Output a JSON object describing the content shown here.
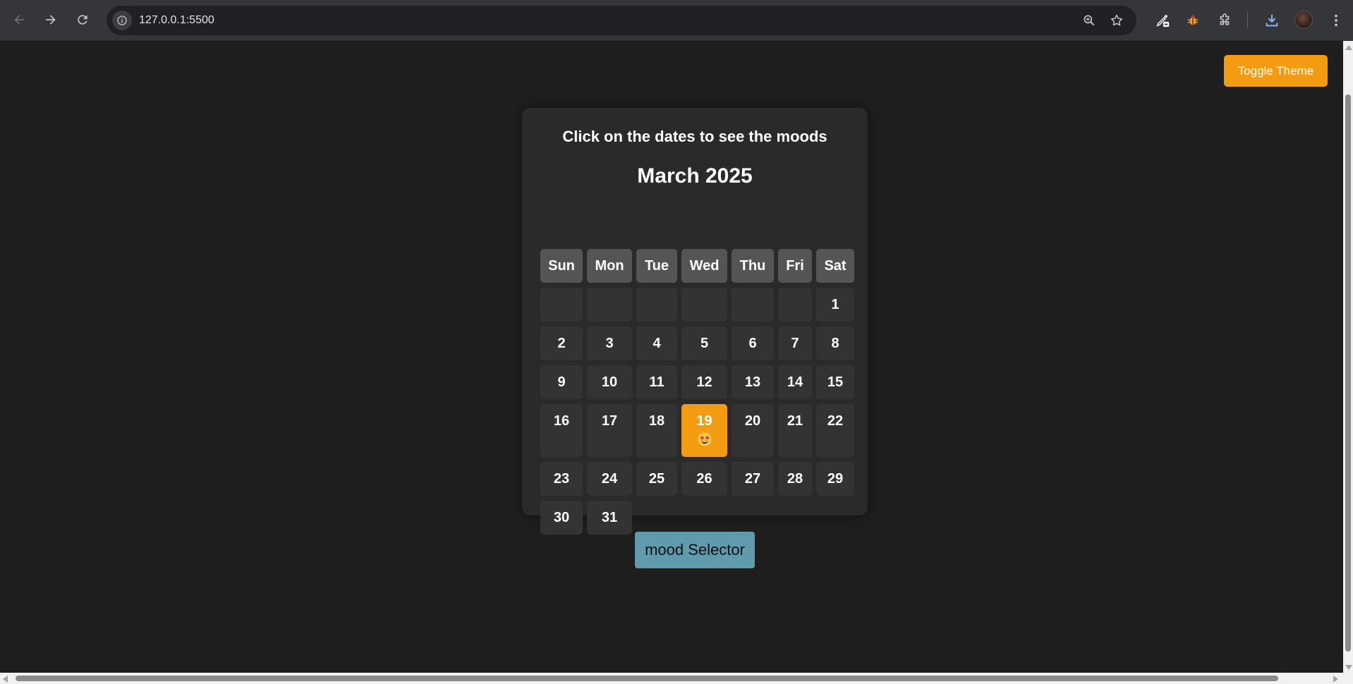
{
  "browser": {
    "url": "127.0.0.1:5500",
    "icons": [
      "back-arrow-icon",
      "forward-arrow-icon",
      "reload-icon",
      "site-info-icon",
      "zoom-icon",
      "bookmark-star-icon",
      "eyedropper-extension-icon",
      "bug-extension-icon",
      "extensions-puzzle-icon",
      "download-icon",
      "profile-avatar",
      "more-menu-icon"
    ]
  },
  "page": {
    "toggle_theme_label": "Toggle Theme",
    "hint": "Click on the dates to see the moods",
    "month_title": "March 2025",
    "weekdays": [
      "Sun",
      "Mon",
      "Tue",
      "Wed",
      "Thu",
      "Fri",
      "Sat"
    ],
    "weeks": [
      [
        "",
        "",
        "",
        "",
        "",
        "",
        "1"
      ],
      [
        "2",
        "3",
        "4",
        "5",
        "6",
        "7",
        "8"
      ],
      [
        "9",
        "10",
        "11",
        "12",
        "13",
        "14",
        "15"
      ],
      [
        "16",
        "17",
        "18",
        "19",
        "20",
        "21",
        "22"
      ],
      [
        "23",
        "24",
        "25",
        "26",
        "27",
        "28",
        "29"
      ],
      [
        "30",
        "31"
      ]
    ],
    "selected_day": "19",
    "selected_mood_icon": "star-struck-emoji-icon",
    "mood_selector_label": "mood Selector"
  },
  "colors": {
    "background": "#1e1e1e",
    "card": "#2a2a2a",
    "weekday_cell": "#555555",
    "day_cell": "#333333",
    "accent_orange": "#f39c12",
    "mood_button": "#5f9aad"
  }
}
